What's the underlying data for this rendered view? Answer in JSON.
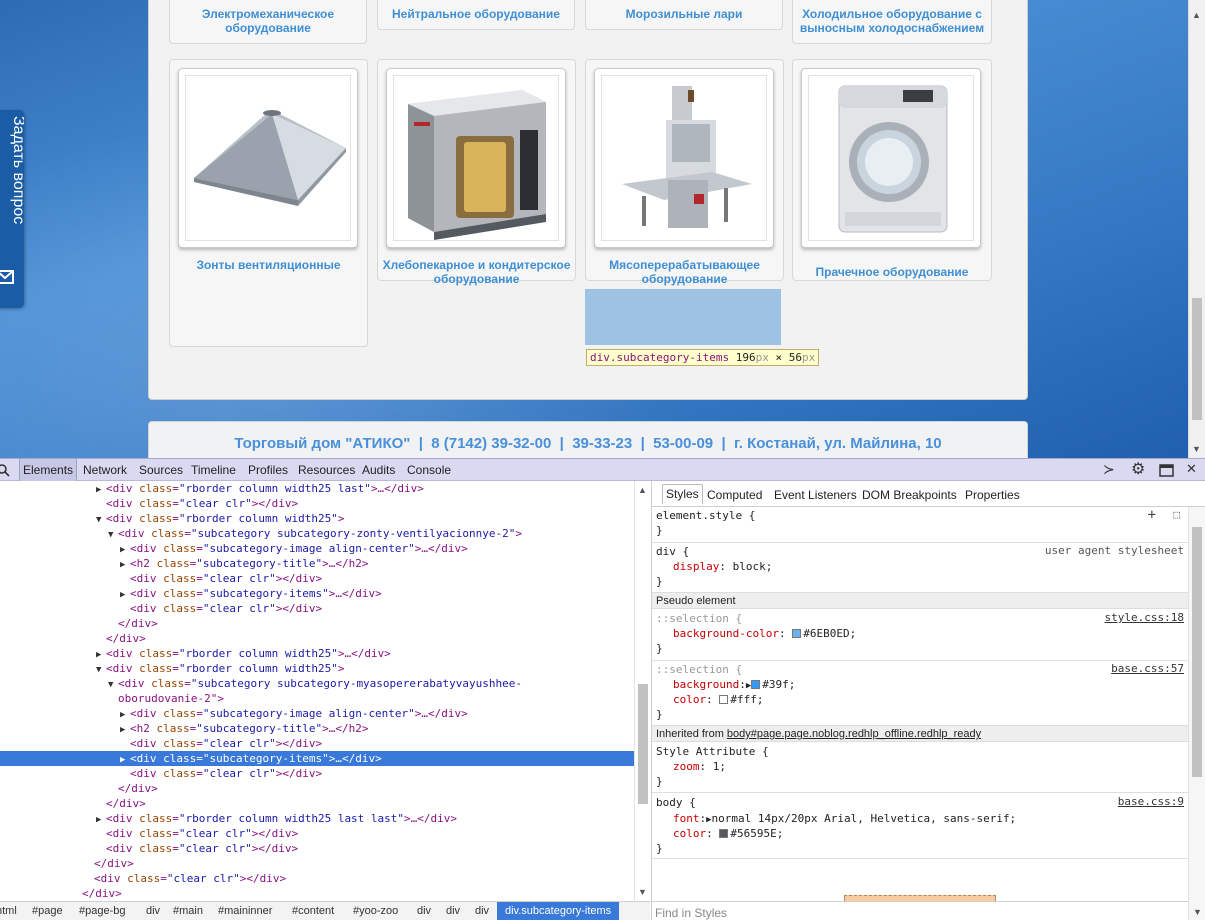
{
  "page": {
    "top_row_titles": [
      "Электромеханическое оборудование",
      "Нейтральное оборудование",
      "Морозильные лари",
      "Холодильное оборудование с выносным холодоснабжением"
    ],
    "cards": [
      {
        "title": "Зонты вентиляционные",
        "icon": "ventilation-hood-image"
      },
      {
        "title": "Хлебопекарное и кондитерское оборудование",
        "icon": "bakery-oven-image"
      },
      {
        "title": "Мясоперерабатывающее оборудование",
        "icon": "meat-band-saw-image"
      },
      {
        "title": "Прачечное оборудование",
        "icon": "washing-machine-image"
      }
    ],
    "ask_tab_label": "Задать вопрос",
    "footer_text": "Торговый дом \"АТИКО\"  |  8 (7142) 39-32-00  |  39-33-23  |  53-00-09  |  г. Костанай, ул. Майлина, 10",
    "highlight_tooltip": {
      "selector": "div.subcategory-items",
      "w": "196",
      "h": "56",
      "px": "px",
      "times": " × "
    }
  },
  "devtools": {
    "tabs": [
      "Elements",
      "Network",
      "Sources",
      "Timeline",
      "Profiles",
      "Resources",
      "Audits",
      "Console"
    ],
    "active_tab": "Elements",
    "dom_lines": [
      {
        "tri": "▶",
        "tag": "<div ",
        "an": "class",
        "av": "\"rborder column width25 last\"",
        "tail": ">…</div>"
      },
      {
        "tri": "",
        "tag": "<div ",
        "an": "class",
        "av": "\"clear clr\"",
        "tail": "></div>"
      },
      {
        "tri": "▼",
        "tag": "<div ",
        "an": "class",
        "av": "\"rborder column width25\"",
        "tail": ">"
      },
      {
        "tri": "▼",
        "tag": "<div ",
        "an": "class",
        "av": "\"subcategory subcategory-zonty-ventilyacionnye-2\"",
        "tail": ">"
      },
      {
        "tri": "▶",
        "tag": "<div ",
        "an": "class",
        "av": "\"subcategory-image align-center\"",
        "tail": ">…</div>"
      },
      {
        "tri": "▶",
        "tag": "<h2 ",
        "an": "class",
        "av": "\"subcategory-title\"",
        "tail": ">…</h2>"
      },
      {
        "tri": "",
        "tag": "<div ",
        "an": "class",
        "av": "\"clear clr\"",
        "tail": "></div>"
      },
      {
        "tri": "▶",
        "tag": "<div ",
        "an": "class",
        "av": "\"subcategory-items\"",
        "tail": ">…</div>"
      },
      {
        "tri": "",
        "tag": "<div ",
        "an": "class",
        "av": "\"clear clr\"",
        "tail": "></div>"
      },
      {
        "tri": "",
        "tag": "</div>",
        "an": "",
        "av": "",
        "tail": ""
      },
      {
        "tri": "",
        "tag": "</div>",
        "an": "",
        "av": "",
        "tail": ""
      },
      {
        "tri": "▶",
        "tag": "<div ",
        "an": "class",
        "av": "\"rborder column width25\"",
        "tail": ">…</div>"
      },
      {
        "tri": "▼",
        "tag": "<div ",
        "an": "class",
        "av": "\"rborder column width25\"",
        "tail": ">"
      },
      {
        "tri": "▼",
        "tag": "<div ",
        "an": "class",
        "av": "\"subcategory subcategory-myasopererabatyvayushhee-",
        "tail": ""
      },
      {
        "tri": "",
        "tag": "oborudovanie-2\"",
        "an": "",
        "av": "",
        "tail": ">"
      },
      {
        "tri": "▶",
        "tag": "<div ",
        "an": "class",
        "av": "\"subcategory-image align-center\"",
        "tail": ">…</div>"
      },
      {
        "tri": "▶",
        "tag": "<h2 ",
        "an": "class",
        "av": "\"subcategory-title\"",
        "tail": ">…</h2>"
      },
      {
        "tri": "",
        "tag": "<div ",
        "an": "class",
        "av": "\"clear clr\"",
        "tail": "></div>"
      },
      {
        "tri": "▶",
        "tag": "<div ",
        "an": "class",
        "av": "\"subcategory-items\"",
        "tail": ">…</div>"
      },
      {
        "tri": "",
        "tag": "<div ",
        "an": "class",
        "av": "\"clear clr\"",
        "tail": "></div>"
      },
      {
        "tri": "",
        "tag": "</div>",
        "an": "",
        "av": "",
        "tail": ""
      },
      {
        "tri": "",
        "tag": "</div>",
        "an": "",
        "av": "",
        "tail": ""
      },
      {
        "tri": "▶",
        "tag": "<div ",
        "an": "class",
        "av": "\"rborder column width25 last last\"",
        "tail": ">…</div>"
      },
      {
        "tri": "",
        "tag": "<div ",
        "an": "class",
        "av": "\"clear clr\"",
        "tail": "></div>"
      },
      {
        "tri": "",
        "tag": "<div ",
        "an": "class",
        "av": "\"clear clr\"",
        "tail": "></div>"
      },
      {
        "tri": "",
        "tag": "</div>",
        "an": "",
        "av": "",
        "tail": ""
      },
      {
        "tri": "",
        "tag": "<div ",
        "an": "class",
        "av": "\"clear clr\"",
        "tail": "></div>"
      },
      {
        "tri": "",
        "tag": "</div>",
        "an": "",
        "av": "",
        "tail": ""
      }
    ],
    "breadcrumbs": [
      "html",
      "#page",
      "#page-bg",
      "div",
      "#main",
      "#maininner",
      "#content",
      "#yoo-zoo",
      "div",
      "div",
      "div",
      "div.subcategory-items"
    ],
    "styles_tabs": [
      "Styles",
      "Computed",
      "Event Listeners",
      "DOM Breakpoints",
      "Properties"
    ],
    "styles": {
      "element_style": "element.style {",
      "close": "}",
      "div_selector": "div {",
      "ua_label": "user agent stylesheet",
      "display_prop": "display",
      "display_val": "block;",
      "pseudo_header": "Pseudo element",
      "sel1_selector": "::selection {",
      "sel1_src": "style.css:18",
      "sel1_prop": "background-color",
      "sel1_val": "#6EB0ED;",
      "sel2_selector": "::selection {",
      "sel2_src": "base.css:57",
      "sel2_bg_prop": "background",
      "sel2_bg_val": "#39f;",
      "sel2_color_prop": "color",
      "sel2_color_val": "#fff;",
      "inherited_prefix": "Inherited from ",
      "inherited_link": "body#page.page.noblog.redhlp_offline.redhlp_ready",
      "style_attr": "Style Attribute {",
      "zoom_prop": "zoom",
      "zoom_val": "1;",
      "body_selector": "body {",
      "body_src": "base.css:9",
      "font_prop": "font",
      "font_val": "normal 14px/20px Arial, Helvetica, sans-serif;",
      "color_prop": "color",
      "color_val": "#56595E;",
      "find_placeholder": "Find in Styles"
    },
    "colors": {
      "swatch1": "#6EB0ED",
      "swatch2": "#3399ff",
      "swatch3": "#ffffff",
      "swatch4": "#56595E"
    }
  }
}
